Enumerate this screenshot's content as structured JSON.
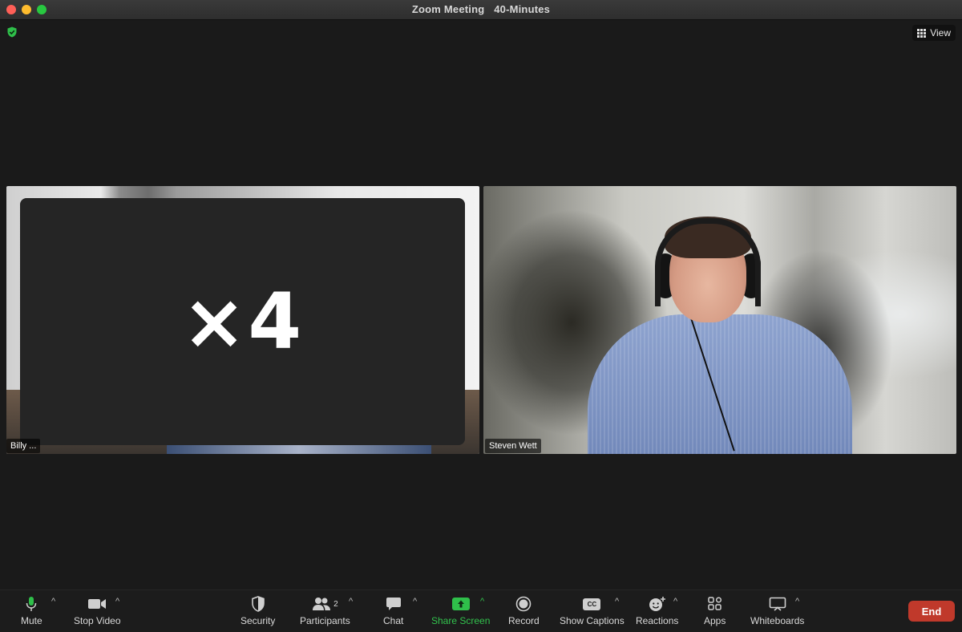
{
  "window": {
    "title": "Zoom Meeting",
    "time_limit": "40-Minutes"
  },
  "header": {
    "view_label": "View"
  },
  "overlay": {
    "text": "×4"
  },
  "participants": [
    {
      "name": "Billy ..."
    },
    {
      "name": "Steven Wett"
    }
  ],
  "toolbar": {
    "mute": "Mute",
    "stop_video": "Stop Video",
    "security": "Security",
    "participants": "Participants",
    "participants_count": "2",
    "chat": "Chat",
    "share_screen": "Share Screen",
    "record": "Record",
    "show_captions": "Show Captions",
    "captions_icon_text": "CC",
    "reactions": "Reactions",
    "apps": "Apps",
    "whiteboards": "Whiteboards",
    "end": "End"
  },
  "colors": {
    "accent_green": "#32c24d",
    "end_red": "#c0392b",
    "background": "#1a1a1a"
  }
}
